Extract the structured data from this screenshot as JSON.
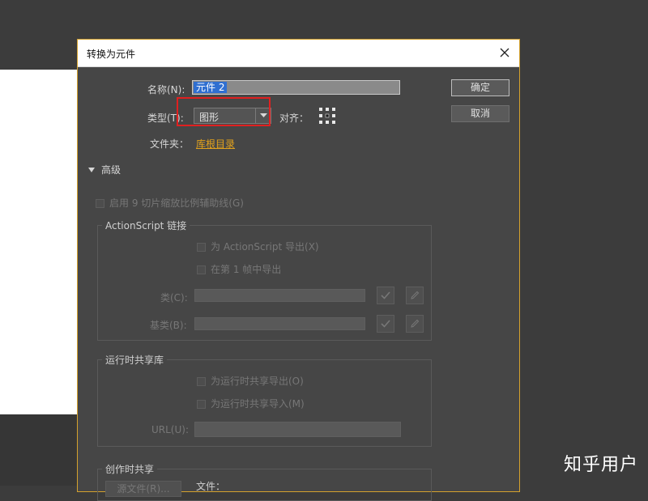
{
  "dialog": {
    "title": "转换为元件",
    "name_label": "名称(N):",
    "name_value": "元件 2",
    "ok_button": "确定",
    "cancel_button": "取消",
    "type_label": "类型(T):",
    "type_value": "图形",
    "align_label": "对齐：",
    "folder_label": "文件夹：",
    "folder_value": "库根目录",
    "advanced_label": "高级",
    "nine_slice": "启用 9 切片缩放比例辅助线(G)",
    "actionscript": {
      "title": "ActionScript 链接",
      "export_for_as": "为 ActionScript 导出(X)",
      "export_in_frame": "在第 1 帧中导出",
      "class_label": "类(C):",
      "base_class_label": "基类(B):"
    },
    "runtime_sharing": {
      "title": "运行时共享库",
      "export_runtime": "为运行时共享导出(O)",
      "import_runtime": "为运行时共享导入(M)",
      "url_label": "URL(U):"
    },
    "authortime_sharing": {
      "title": "创作时共享",
      "source_file_button": "源文件(R)...",
      "file_label": "文件："
    }
  },
  "watermark": "知乎用户",
  "colors": {
    "background": "#3c3c3c",
    "dialog": "#464646",
    "accent_border": "#d4a12d",
    "selection": "#2f6fd1",
    "link": "#e3a21c",
    "highlight_box": "#e02020"
  },
  "icons": {
    "close": "close-icon",
    "dropdown": "chevron-down-icon",
    "align": "registration-grid-icon",
    "expand": "triangle-down-icon",
    "validate": "checkmark-icon",
    "edit": "pencil-icon"
  }
}
